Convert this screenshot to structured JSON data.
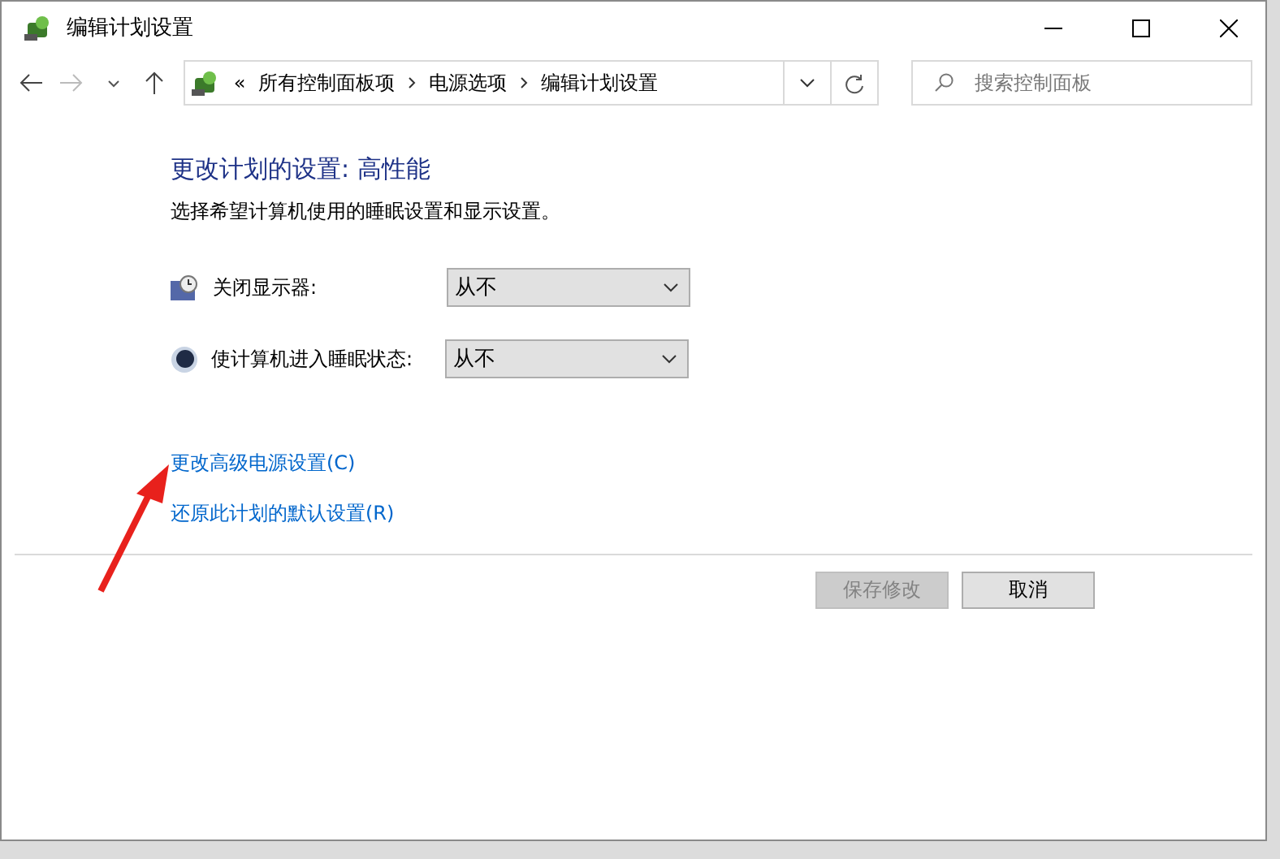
{
  "window": {
    "title": "编辑计划设置"
  },
  "address_bar": {
    "prefix": "«",
    "crumbs": [
      "所有控制面板项",
      "电源选项",
      "编辑计划设置"
    ]
  },
  "search": {
    "placeholder": "搜索控制面板"
  },
  "heading": "更改计划的设置: 高性能",
  "description": "选择希望计算机使用的睡眠设置和显示设置。",
  "settings": [
    {
      "kind": "display",
      "label": "关闭显示器:",
      "value": "从不"
    },
    {
      "kind": "sleep",
      "label": "使计算机进入睡眠状态:",
      "value": "从不"
    }
  ],
  "links": [
    "更改高级电源设置(C)",
    "还原此计划的默认设置(R)"
  ],
  "buttons": [
    {
      "label": "保存修改",
      "disabled": true
    },
    {
      "label": "取消",
      "disabled": false
    }
  ]
}
